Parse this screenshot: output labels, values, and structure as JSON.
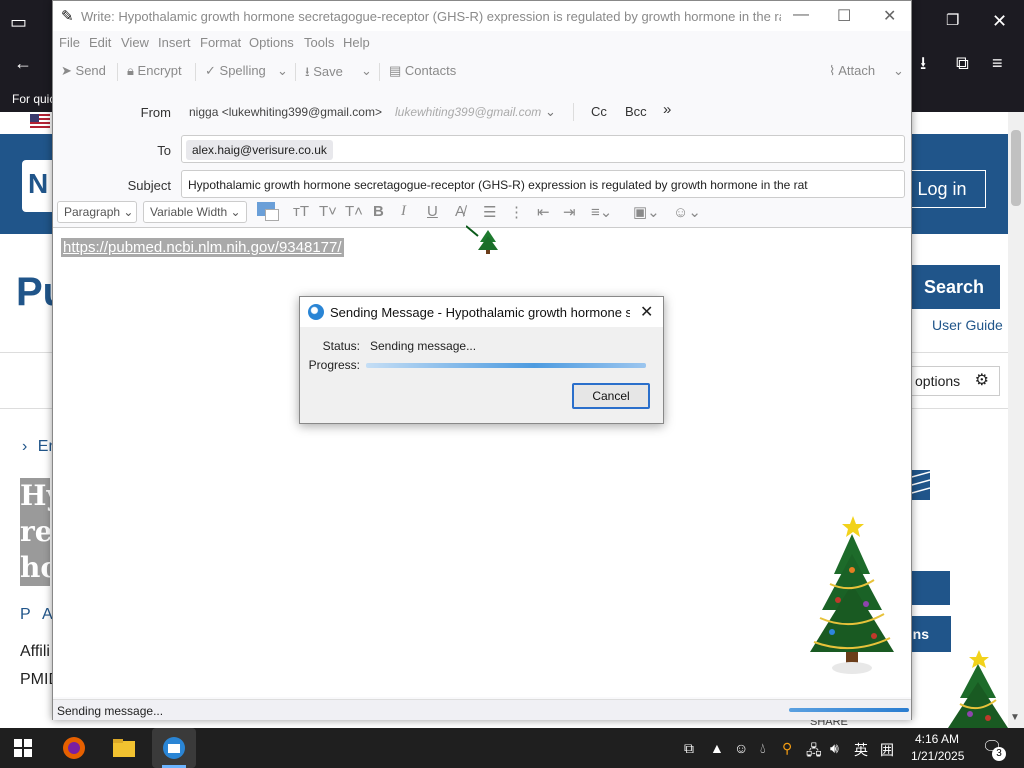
{
  "compose": {
    "title": "Write: Hypothalamic growth hormone secretagogue-receptor (GHS-R) expression is regulated by growth hormone in the rat - Th...",
    "menu": [
      "File",
      "Edit",
      "View",
      "Insert",
      "Format",
      "Options",
      "Tools",
      "Help"
    ],
    "toolbar": {
      "send": "Send",
      "encrypt": "Encrypt",
      "spelling": "Spelling",
      "save": "Save",
      "contacts": "Contacts",
      "attach": "Attach"
    },
    "from_label": "From",
    "from_value": "nigga <lukewhiting399@gmail.com>",
    "from_alias": "lukewhiting399@gmail.com",
    "cc": "Cc",
    "bcc": "Bcc",
    "to_label": "To",
    "to_value": "alex.haig@verisure.co.uk",
    "subject_label": "Subject",
    "subject_value": "Hypothalamic growth hormone secretagogue-receptor (GHS-R) expression is regulated by growth hormone in the rat",
    "format": {
      "paragraph": "Paragraph",
      "font": "Variable Width"
    },
    "body_link": "https://pubmed.ncbi.nlm.nih.gov/9348177/",
    "status_text": "Sending message..."
  },
  "dialog": {
    "title": "Sending Message - Hypothalamic growth hormone sec...",
    "status_label": "Status:",
    "status_value": "Sending message...",
    "progress_label": "Progress:",
    "cancel": "Cancel"
  },
  "background_page": {
    "for_quick": "For quic",
    "login": "Log in",
    "pub": "Pu",
    "search": "Search",
    "user_guide": "User Guide",
    "options": "options",
    "en": "En",
    "article_title": "Hy re ho",
    "pa": "P A",
    "affil": "Affili",
    "pmid": "PMID",
    "side_btn": "ns",
    "share": "SHARE"
  },
  "taskbar": {
    "time": "4:16 AM",
    "date": "1/21/2025",
    "ime": "英",
    "notifications": "3"
  }
}
